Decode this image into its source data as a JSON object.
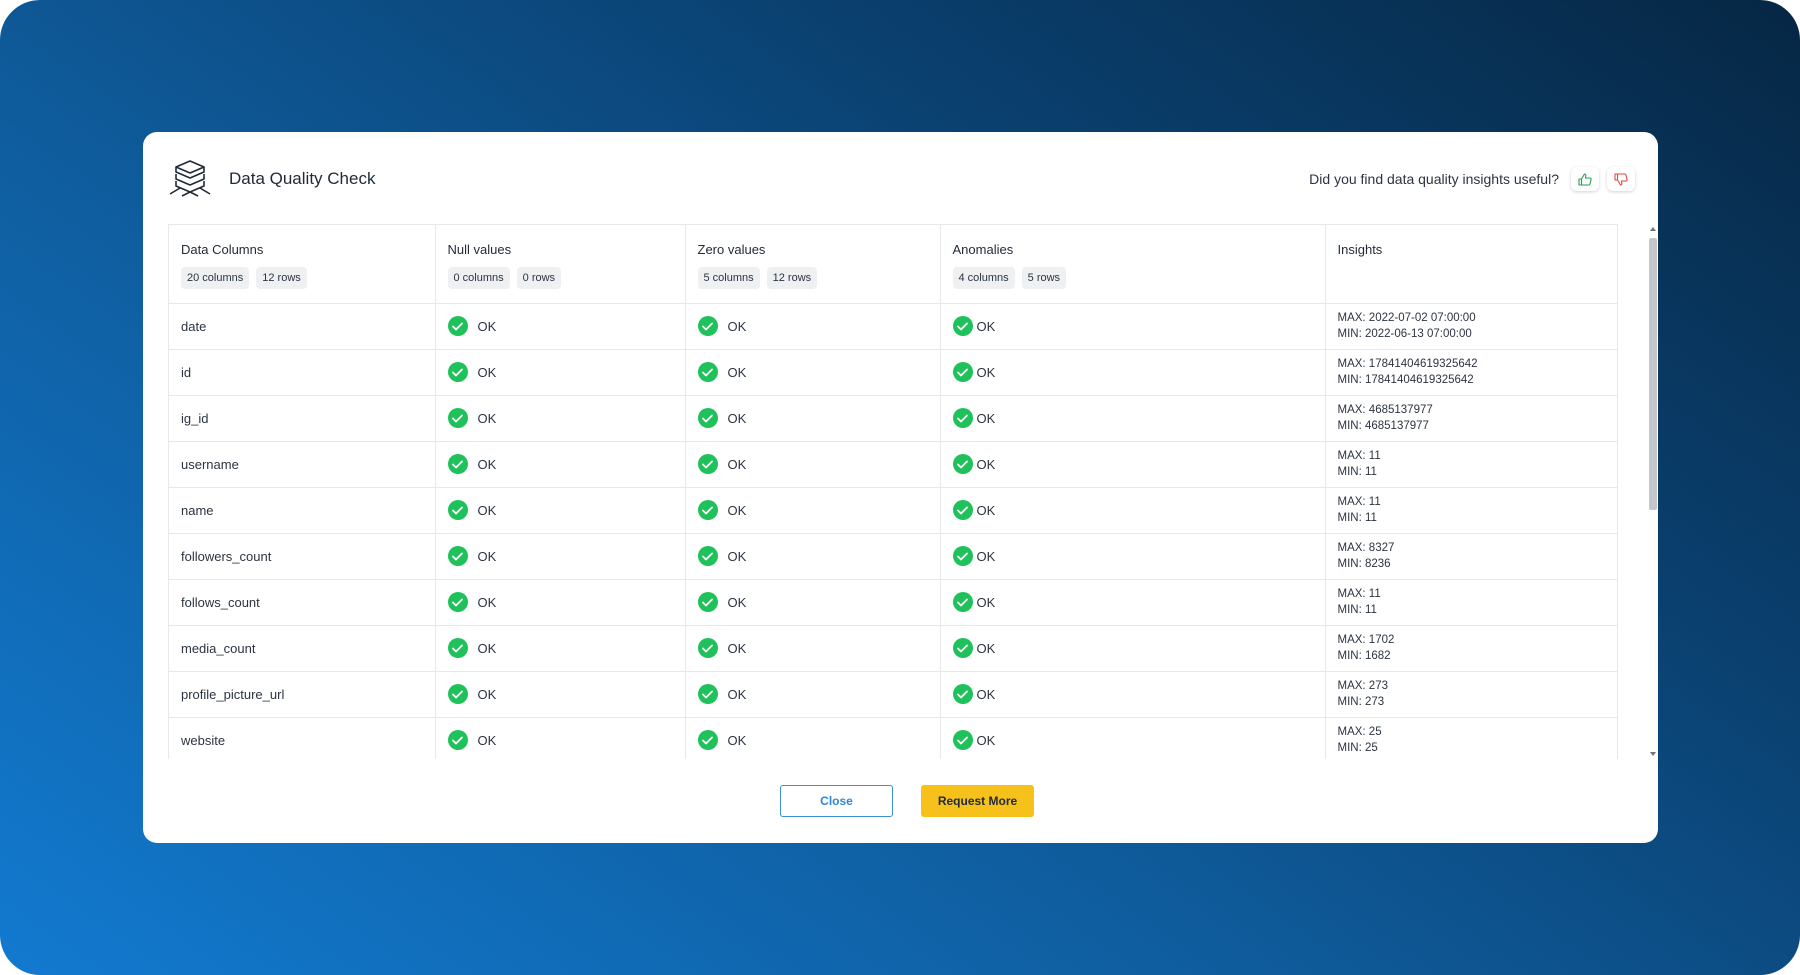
{
  "modal": {
    "title": "Data Quality Check",
    "feedback_question": "Did you find data quality insights useful?",
    "thumbs_up_icon": "thumbs-up-icon",
    "thumbs_down_icon": "thumbs-down-icon",
    "colors": {
      "ok_green": "#1fc15b",
      "primary_button": "#f5c11a",
      "secondary_border": "#3b8fd8"
    }
  },
  "table": {
    "headers": [
      {
        "label": "Data Columns",
        "pills": [
          "20 columns",
          "12 rows"
        ]
      },
      {
        "label": "Null values",
        "pills": [
          "0 columns",
          "0 rows"
        ]
      },
      {
        "label": "Zero values",
        "pills": [
          "5 columns",
          "12 rows"
        ]
      },
      {
        "label": "Anomalies",
        "pills": [
          "4 columns",
          "5 rows"
        ]
      },
      {
        "label": "Insights",
        "pills": []
      }
    ],
    "rows": [
      {
        "column": "date",
        "null": "OK",
        "zero": "OK",
        "anomalies": "OK",
        "max": "MAX: 2022-07-02 07:00:00",
        "min": "MIN: 2022-06-13 07:00:00"
      },
      {
        "column": "id",
        "null": "OK",
        "zero": "OK",
        "anomalies": "OK",
        "max": "MAX: 17841404619325642",
        "min": "MIN: 17841404619325642"
      },
      {
        "column": "ig_id",
        "null": "OK",
        "zero": "OK",
        "anomalies": "OK",
        "max": "MAX: 4685137977",
        "min": "MIN: 4685137977"
      },
      {
        "column": "username",
        "null": "OK",
        "zero": "OK",
        "anomalies": "OK",
        "max": "MAX: 11",
        "min": "MIN: 11"
      },
      {
        "column": "name",
        "null": "OK",
        "zero": "OK",
        "anomalies": "OK",
        "max": "MAX: 11",
        "min": "MIN: 11"
      },
      {
        "column": "followers_count",
        "null": "OK",
        "zero": "OK",
        "anomalies": "OK",
        "max": "MAX: 8327",
        "min": "MIN: 8236"
      },
      {
        "column": "follows_count",
        "null": "OK",
        "zero": "OK",
        "anomalies": "OK",
        "max": "MAX: 11",
        "min": "MIN: 11"
      },
      {
        "column": "media_count",
        "null": "OK",
        "zero": "OK",
        "anomalies": "OK",
        "max": "MAX: 1702",
        "min": "MIN: 1682"
      },
      {
        "column": "profile_picture_url",
        "null": "OK",
        "zero": "OK",
        "anomalies": "OK",
        "max": "MAX: 273",
        "min": "MIN: 273"
      },
      {
        "column": "website",
        "null": "OK",
        "zero": "OK",
        "anomalies": "OK",
        "max": "MAX: 25",
        "min": "MIN: 25"
      }
    ]
  },
  "footer": {
    "close_label": "Close",
    "request_more_label": "Request More"
  }
}
